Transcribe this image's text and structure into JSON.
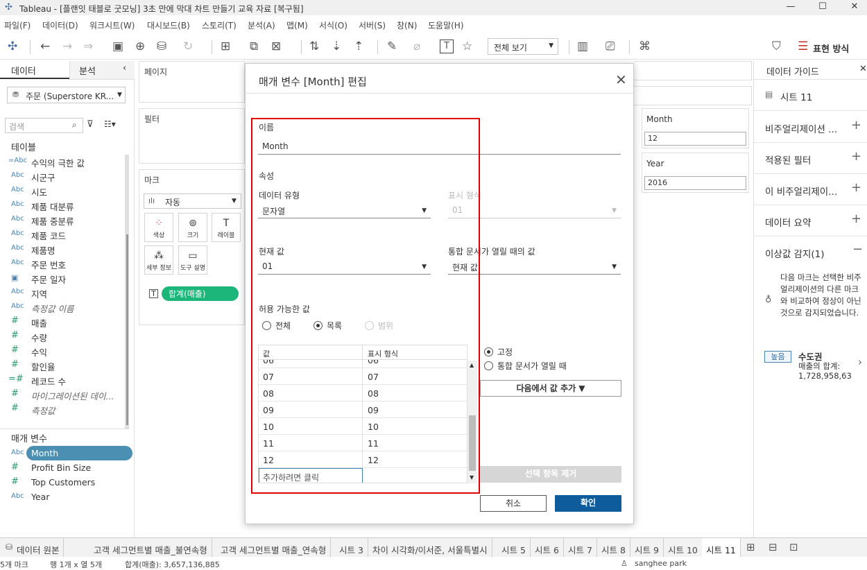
{
  "window": {
    "title": "Tableau - [플랜잇 태블로 굿모닝] 3초 만에 막대 차트 만들기 교육 자료 [복구됨]"
  },
  "menu": [
    "파일(F)",
    "데이터(D)",
    "워크시트(W)",
    "대시보드(B)",
    "스토리(T)",
    "분석(A)",
    "맵(M)",
    "서식(O)",
    "서버(S)",
    "창(N)",
    "도움말(H)"
  ],
  "toolbar": {
    "view_select": "전체 보기",
    "show_me": "표현 방식"
  },
  "left": {
    "tab_data": "데이터",
    "tab_analysis": "분석",
    "datasource": "주문 (Superstore KR...",
    "search_placeholder": "검색",
    "tables_header": "테이블",
    "fields": [
      {
        "type": "=Abc",
        "name": "수익의 극한 값"
      },
      {
        "type": "Abc",
        "name": "시군구"
      },
      {
        "type": "Abc",
        "name": "시도"
      },
      {
        "type": "Abc",
        "name": "제품 대분류"
      },
      {
        "type": "Abc",
        "name": "제품 중분류"
      },
      {
        "type": "Abc",
        "name": "제품 코드"
      },
      {
        "type": "Abc",
        "name": "제품명"
      },
      {
        "type": "Abc",
        "name": "주문 번호"
      },
      {
        "type": "date",
        "name": "주문 일자"
      },
      {
        "type": "Abc",
        "name": "지역"
      },
      {
        "type": "Abc",
        "name": "측정값 이름"
      },
      {
        "type": "#",
        "name": "매출"
      },
      {
        "type": "#",
        "name": "수량"
      },
      {
        "type": "#",
        "name": "수익"
      },
      {
        "type": "#",
        "name": "할인율"
      },
      {
        "type": "=#",
        "name": "레코드 수"
      },
      {
        "type": "#",
        "name": "마이그레이션된 데이..."
      },
      {
        "type": "#",
        "name": "측정값"
      }
    ],
    "params_header": "매개 변수",
    "params": [
      {
        "type": "Abc",
        "name": "Month"
      },
      {
        "type": "#",
        "name": "Profit Bin Size"
      },
      {
        "type": "#",
        "name": "Top Customers"
      },
      {
        "type": "Abc",
        "name": "Year"
      }
    ]
  },
  "shelves": {
    "pages": "페이지",
    "filters": "필터",
    "marks": "마크",
    "mark_type": "자동",
    "color": "색상",
    "size": "크기",
    "label": "레이블",
    "detail": "세부 정보",
    "tooltip": "도구 설명",
    "pill": "합계(매출)"
  },
  "dialog": {
    "title": "매개 변수 [Month] 편집",
    "name_label": "이름",
    "name_value": "Month",
    "props_label": "속성",
    "dtype_label": "데이터 유형",
    "dtype_value": "문자열",
    "format_label": "표시 형식",
    "format_value": "01",
    "current_label": "현재 값",
    "current_value": "01",
    "open_label": "통합 문서가 열릴 때의 값",
    "open_value": "현재 값",
    "allowed_label": "허용 가능한 값",
    "allowed_all": "전체",
    "allowed_list": "목록",
    "allowed_range": "범위",
    "col_value": "값",
    "col_display": "표시 형식",
    "partial_row": "06",
    "rows": [
      [
        "07",
        "07"
      ],
      [
        "08",
        "08"
      ],
      [
        "09",
        "09"
      ],
      [
        "10",
        "10"
      ],
      [
        "11",
        "11"
      ],
      [
        "12",
        "12"
      ]
    ],
    "add_placeholder": "추가하려면 클릭",
    "fixed": "고정",
    "when_open": "통합 문서가 열릴 때",
    "add_from": "다음에서 값 추가 ▼",
    "remove": "선택 항목 제거",
    "cancel": "취소",
    "ok": "확인"
  },
  "param_cards": [
    {
      "name": "Month",
      "value": "12"
    },
    {
      "name": "Year",
      "value": "2016"
    }
  ],
  "right": {
    "header": "데이터 가이드",
    "sheet": "시트 11",
    "items": [
      "비주얼리제이션 ...",
      "적용된 필터",
      "이 비주얼리제이...",
      "데이터 요약"
    ],
    "outlier_title": "이상값 감지(1)",
    "outlier_desc": "다음 마크는 선택한 비주얼리제이션의 다른 마크와 비교하여 정상이 아닌 것으로 감지되었습니다.",
    "badge": "높음",
    "outlier_name": "수도권",
    "outlier_metric": "매출의 합계:",
    "outlier_value": "1,728,958,63"
  },
  "tabs": [
    "데이터 원본",
    "고객 세그먼트별 매출_불연속형",
    "고객 세그먼트별 매출_연속형",
    "시트 3",
    "차이 시각화/이서준, 서울특별시",
    "시트 5",
    "시트 6",
    "시트 7",
    "시트 8",
    "시트 9",
    "시트 10",
    "시트 11"
  ],
  "status": {
    "marks": "5개 마크",
    "rows": "행 1개 x 열 5개",
    "sum": "합계(매출): 3,657,136,885",
    "user": "sanghee park"
  },
  "colors": {
    "accent": "#0f5c9c",
    "pill": "#1cb57a",
    "highlight_border": "#e00000",
    "param_selected": "#4b8fb2"
  }
}
